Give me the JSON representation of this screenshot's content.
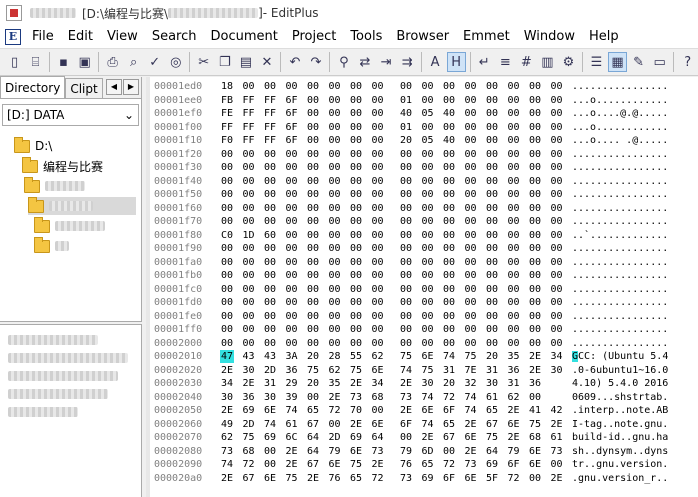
{
  "window": {
    "path": "[D:\\编程与比赛\\",
    "path_tail": "]",
    "app_name": " - EditPlus"
  },
  "menu": [
    "File",
    "Edit",
    "View",
    "Search",
    "Document",
    "Project",
    "Tools",
    "Browser",
    "Emmet",
    "Window",
    "Help"
  ],
  "toolbar": {
    "icons": [
      "new-file",
      "open-folder",
      "save",
      "save-all",
      "print",
      "print-preview",
      "spell-check",
      "web-preview",
      "cut",
      "copy",
      "paste",
      "delete",
      "undo",
      "redo",
      "find",
      "replace",
      "go-to",
      "indent",
      "font-size",
      "hex-view",
      "word-wrap",
      "ruler",
      "line-numbers",
      "column-select",
      "settings",
      "document-list",
      "directory-panel",
      "cliptext",
      "output-window",
      "help"
    ]
  },
  "left_panel": {
    "tabs": [
      "Directory",
      "Clipt"
    ],
    "tab_left_arrow": "◀",
    "tab_right_arrow": "▶",
    "drive": "[D:] DATA",
    "drive_arrow": "⌄",
    "tree": [
      {
        "label": "D:\\",
        "blurred": false
      },
      {
        "label": "编程与比赛",
        "blurred": false
      },
      {
        "label": "",
        "blurred": true
      },
      {
        "label": "",
        "blurred": true
      },
      {
        "label": "",
        "blurred": true
      },
      {
        "label": "",
        "blurred": true
      }
    ]
  },
  "hex": {
    "rows": [
      {
        "addr": "00001ed0",
        "bytes": [
          "18",
          "00",
          "00",
          "00",
          "00",
          "00",
          "00",
          "00",
          "00",
          "00",
          "00",
          "00",
          "00",
          "00",
          "00",
          "00"
        ],
        "ascii": "................"
      },
      {
        "addr": "00001ee0",
        "bytes": [
          "FB",
          "FF",
          "FF",
          "6F",
          "00",
          "00",
          "00",
          "00",
          "01",
          "00",
          "00",
          "00",
          "00",
          "00",
          "00",
          "00"
        ],
        "ascii": "...o............"
      },
      {
        "addr": "00001ef0",
        "bytes": [
          "FE",
          "FF",
          "FF",
          "6F",
          "00",
          "00",
          "00",
          "00",
          "40",
          "05",
          "40",
          "00",
          "00",
          "00",
          "00",
          "00"
        ],
        "ascii": "...o....@.@....."
      },
      {
        "addr": "00001f00",
        "bytes": [
          "FF",
          "FF",
          "FF",
          "6F",
          "00",
          "00",
          "00",
          "00",
          "01",
          "00",
          "00",
          "00",
          "00",
          "00",
          "00",
          "00"
        ],
        "ascii": "...o............"
      },
      {
        "addr": "00001f10",
        "bytes": [
          "F0",
          "FF",
          "FF",
          "6F",
          "00",
          "00",
          "00",
          "00",
          "20",
          "05",
          "40",
          "00",
          "00",
          "00",
          "00",
          "00"
        ],
        "ascii": "...o.... .@....."
      },
      {
        "addr": "00001f20",
        "bytes": [
          "00",
          "00",
          "00",
          "00",
          "00",
          "00",
          "00",
          "00",
          "00",
          "00",
          "00",
          "00",
          "00",
          "00",
          "00",
          "00"
        ],
        "ascii": "................"
      },
      {
        "addr": "00001f30",
        "bytes": [
          "00",
          "00",
          "00",
          "00",
          "00",
          "00",
          "00",
          "00",
          "00",
          "00",
          "00",
          "00",
          "00",
          "00",
          "00",
          "00"
        ],
        "ascii": "................"
      },
      {
        "addr": "00001f40",
        "bytes": [
          "00",
          "00",
          "00",
          "00",
          "00",
          "00",
          "00",
          "00",
          "00",
          "00",
          "00",
          "00",
          "00",
          "00",
          "00",
          "00"
        ],
        "ascii": "................"
      },
      {
        "addr": "00001f50",
        "bytes": [
          "00",
          "00",
          "00",
          "00",
          "00",
          "00",
          "00",
          "00",
          "00",
          "00",
          "00",
          "00",
          "00",
          "00",
          "00",
          "00"
        ],
        "ascii": "................"
      },
      {
        "addr": "00001f60",
        "bytes": [
          "00",
          "00",
          "00",
          "00",
          "00",
          "00",
          "00",
          "00",
          "00",
          "00",
          "00",
          "00",
          "00",
          "00",
          "00",
          "00"
        ],
        "ascii": "................"
      },
      {
        "addr": "00001f70",
        "bytes": [
          "00",
          "00",
          "00",
          "00",
          "00",
          "00",
          "00",
          "00",
          "00",
          "00",
          "00",
          "00",
          "00",
          "00",
          "00",
          "00"
        ],
        "ascii": "................"
      },
      {
        "addr": "00001f80",
        "bytes": [
          "C0",
          "1D",
          "60",
          "00",
          "00",
          "00",
          "00",
          "00",
          "00",
          "00",
          "00",
          "00",
          "00",
          "00",
          "00",
          "00"
        ],
        "ascii": "..`............."
      },
      {
        "addr": "00001f90",
        "bytes": [
          "00",
          "00",
          "00",
          "00",
          "00",
          "00",
          "00",
          "00",
          "00",
          "00",
          "00",
          "00",
          "00",
          "00",
          "00",
          "00"
        ],
        "ascii": "................"
      },
      {
        "addr": "00001fa0",
        "bytes": [
          "00",
          "00",
          "00",
          "00",
          "00",
          "00",
          "00",
          "00",
          "00",
          "00",
          "00",
          "00",
          "00",
          "00",
          "00",
          "00"
        ],
        "ascii": "................"
      },
      {
        "addr": "00001fb0",
        "bytes": [
          "00",
          "00",
          "00",
          "00",
          "00",
          "00",
          "00",
          "00",
          "00",
          "00",
          "00",
          "00",
          "00",
          "00",
          "00",
          "00"
        ],
        "ascii": "................"
      },
      {
        "addr": "00001fc0",
        "bytes": [
          "00",
          "00",
          "00",
          "00",
          "00",
          "00",
          "00",
          "00",
          "00",
          "00",
          "00",
          "00",
          "00",
          "00",
          "00",
          "00"
        ],
        "ascii": "................"
      },
      {
        "addr": "00001fd0",
        "bytes": [
          "00",
          "00",
          "00",
          "00",
          "00",
          "00",
          "00",
          "00",
          "00",
          "00",
          "00",
          "00",
          "00",
          "00",
          "00",
          "00"
        ],
        "ascii": "................"
      },
      {
        "addr": "00001fe0",
        "bytes": [
          "00",
          "00",
          "00",
          "00",
          "00",
          "00",
          "00",
          "00",
          "00",
          "00",
          "00",
          "00",
          "00",
          "00",
          "00",
          "00"
        ],
        "ascii": "................"
      },
      {
        "addr": "00001ff0",
        "bytes": [
          "00",
          "00",
          "00",
          "00",
          "00",
          "00",
          "00",
          "00",
          "00",
          "00",
          "00",
          "00",
          "00",
          "00",
          "00",
          "00"
        ],
        "ascii": "................"
      },
      {
        "addr": "00002000",
        "bytes": [
          "00",
          "00",
          "00",
          "00",
          "00",
          "00",
          "00",
          "00",
          "00",
          "00",
          "00",
          "00",
          "00",
          "00",
          "00",
          "00"
        ],
        "ascii": "................"
      },
      {
        "addr": "00002010",
        "bytes": [
          "47",
          "43",
          "43",
          "3A",
          "20",
          "28",
          "55",
          "62",
          "75",
          "6E",
          "74",
          "75",
          "20",
          "35",
          "2E",
          "34"
        ],
        "ascii": "GCC: (Ubuntu 5.4",
        "highlight": 0
      },
      {
        "addr": "00002020",
        "bytes": [
          "2E",
          "30",
          "2D",
          "36",
          "75",
          "62",
          "75",
          "6E",
          "74",
          "75",
          "31",
          "7E",
          "31",
          "36",
          "2E",
          "30"
        ],
        "ascii": ".0-6ubuntu1~16.0"
      },
      {
        "addr": "00002030",
        "bytes": [
          "34",
          "2E",
          "31",
          "29",
          "20",
          "35",
          "2E",
          "34",
          "2E",
          "30",
          "20",
          "32",
          "30",
          "31",
          "36"
        ],
        "ascii": "4.10) 5.4.0 2016"
      },
      {
        "addr": "00002040",
        "bytes": [
          "30",
          "36",
          "30",
          "39",
          "00",
          "2E",
          "73",
          "68",
          "73",
          "74",
          "72",
          "74",
          "61",
          "62",
          "00"
        ],
        "ascii": "0609...shstrtab."
      },
      {
        "addr": "00002050",
        "bytes": [
          "2E",
          "69",
          "6E",
          "74",
          "65",
          "72",
          "70",
          "00",
          "2E",
          "6E",
          "6F",
          "74",
          "65",
          "2E",
          "41",
          "42"
        ],
        "ascii": ".interp..note.AB"
      },
      {
        "addr": "00002060",
        "bytes": [
          "49",
          "2D",
          "74",
          "61",
          "67",
          "00",
          "2E",
          "6E",
          "6F",
          "74",
          "65",
          "2E",
          "67",
          "6E",
          "75",
          "2E"
        ],
        "ascii": "I-tag..note.gnu."
      },
      {
        "addr": "00002070",
        "bytes": [
          "62",
          "75",
          "69",
          "6C",
          "64",
          "2D",
          "69",
          "64",
          "00",
          "2E",
          "67",
          "6E",
          "75",
          "2E",
          "68",
          "61"
        ],
        "ascii": "build-id..gnu.ha"
      },
      {
        "addr": "00002080",
        "bytes": [
          "73",
          "68",
          "00",
          "2E",
          "64",
          "79",
          "6E",
          "73",
          "79",
          "6D",
          "00",
          "2E",
          "64",
          "79",
          "6E",
          "73"
        ],
        "ascii": "sh..dynsym..dyns"
      },
      {
        "addr": "00002090",
        "bytes": [
          "74",
          "72",
          "00",
          "2E",
          "67",
          "6E",
          "75",
          "2E",
          "76",
          "65",
          "72",
          "73",
          "69",
          "6F",
          "6E",
          "00"
        ],
        "ascii": "tr..gnu.version."
      },
      {
        "addr": "000020a0",
        "bytes": [
          "2E",
          "67",
          "6E",
          "75",
          "2E",
          "76",
          "65",
          "72",
          "73",
          "69",
          "6F",
          "6E",
          "5F",
          "72",
          "00",
          "2E"
        ],
        "ascii": ".gnu.version_r.."
      }
    ]
  }
}
